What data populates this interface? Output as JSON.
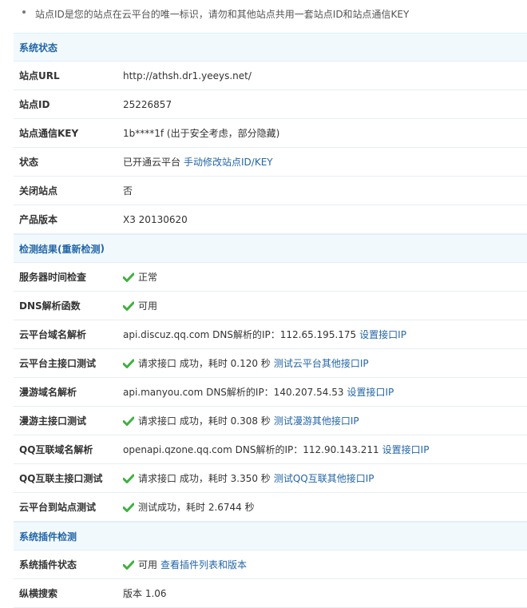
{
  "top_note": "站点ID是您的站点在云平台的唯一标识，请勿和其他站点共用一套站点ID和站点通信KEY",
  "system_status": {
    "title": "系统状态",
    "rows": [
      {
        "label": "站点URL",
        "value": "http://athsh.dr1.yeeys.net/"
      },
      {
        "label": "站点ID",
        "value": "25226857"
      },
      {
        "label": "站点通信KEY",
        "value": "1b****1f (出于安全考虑，部分隐藏)"
      },
      {
        "label": "状态",
        "value": "已开通云平台",
        "link": "手动修改站点ID/KEY"
      },
      {
        "label": "关闭站点",
        "value": "否"
      },
      {
        "label": "产品版本",
        "value": "X3 20130620"
      }
    ]
  },
  "detect": {
    "title_prefix": "检测结果(",
    "title_link": "重新检测",
    "title_suffix": ")",
    "rows": [
      {
        "label": "服务器时间检查",
        "value": "正常"
      },
      {
        "label": "DNS解析函数",
        "value": "可用"
      },
      {
        "label": "云平台域名解析",
        "value": "api.discuz.qq.com DNS解析的IP：112.65.195.175",
        "link": "设置接口IP"
      },
      {
        "label": "云平台主接口测试",
        "value": "请求接口 成功，耗时 0.120 秒",
        "link": "测试云平台其他接口IP"
      },
      {
        "label": "漫游域名解析",
        "value": "api.manyou.com DNS解析的IP：140.207.54.53",
        "link": "设置接口IP"
      },
      {
        "label": "漫游主接口测试",
        "value": "请求接口 成功，耗时 0.308 秒",
        "link": "测试漫游其他接口IP"
      },
      {
        "label": "QQ互联域名解析",
        "value": "openapi.qzone.qq.com DNS解析的IP：112.90.143.211",
        "link": "设置接口IP"
      },
      {
        "label": "QQ互联主接口测试",
        "value": "请求接口 成功，耗时 3.350 秒",
        "link": "测试QQ互联其他接口IP"
      },
      {
        "label": "云平台到站点测试",
        "value": "测试成功，耗时 2.6744 秒"
      }
    ]
  },
  "plugins": {
    "title": "系统插件检测",
    "rows": [
      {
        "label": "系统插件状态",
        "value": "可用",
        "link": "查看插件列表和版本"
      },
      {
        "label": "纵横搜索",
        "value": "版本 1.06"
      }
    ]
  },
  "colors": {
    "accent": "#2366a8",
    "check": "#3fb13f",
    "section_bg": "#f2f9fd"
  }
}
